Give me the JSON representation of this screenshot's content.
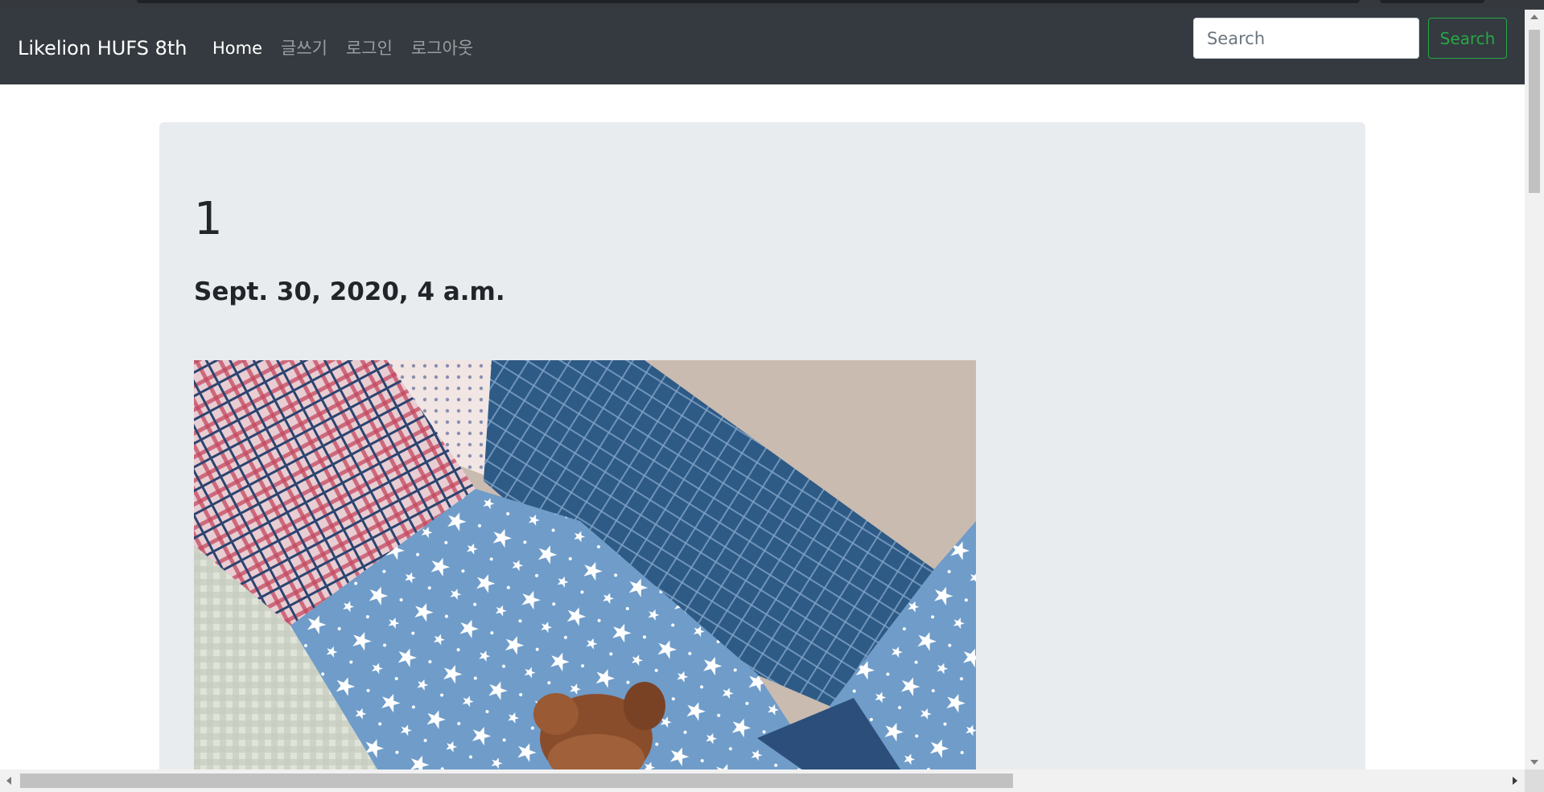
{
  "navbar": {
    "brand": "Likelion HUFS 8th",
    "links": [
      {
        "label": "Home",
        "active": true
      },
      {
        "label": "글쓰기",
        "active": false
      },
      {
        "label": "로그인",
        "active": false
      },
      {
        "label": "로그아웃",
        "active": false
      }
    ],
    "search": {
      "placeholder": "Search",
      "value": ""
    },
    "search_button": "Search"
  },
  "post": {
    "title": "1",
    "date": "Sept. 30, 2020, 4 a.m.",
    "image_subject": "brown teddy bear lying on a patchwork star-print quilt"
  },
  "colors": {
    "navbar_bg": "#343a40",
    "jumbotron_bg": "#e9ecef",
    "search_accent": "#28a745"
  }
}
